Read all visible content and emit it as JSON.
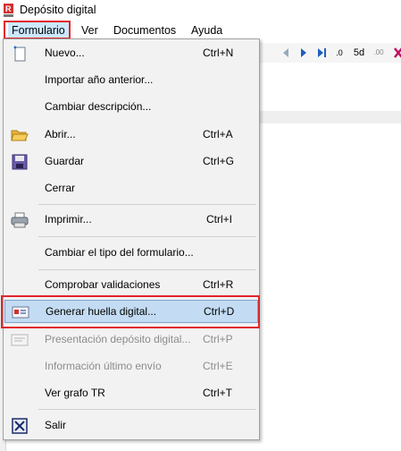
{
  "window": {
    "title": "Depósito digital"
  },
  "menubar": {
    "items": [
      {
        "label": "Formulario"
      },
      {
        "label": "Ver"
      },
      {
        "label": "Documentos"
      },
      {
        "label": "Ayuda"
      }
    ]
  },
  "toolbar": {
    "nav_labels": [
      "5d"
    ],
    "decimal_labels": [
      ".0",
      ".00"
    ]
  },
  "dropdown": {
    "items": [
      {
        "label": "Nuevo...",
        "shortcut": "Ctrl+N",
        "icon": "new-document-icon",
        "enabled": true
      },
      {
        "label": "Importar año anterior...",
        "shortcut": "",
        "enabled": true
      },
      {
        "label": "Cambiar descripción...",
        "shortcut": "",
        "enabled": true
      },
      {
        "label": "Abrir...",
        "shortcut": "Ctrl+A",
        "icon": "open-folder-icon",
        "enabled": true
      },
      {
        "label": "Guardar",
        "shortcut": "Ctrl+G",
        "icon": "save-icon",
        "enabled": true
      },
      {
        "label": "Cerrar",
        "shortcut": "",
        "enabled": true
      },
      {
        "label": "Imprimir...",
        "shortcut": "Ctrl+I",
        "icon": "printer-icon",
        "enabled": true
      },
      {
        "label": "Cambiar el tipo del formulario...",
        "shortcut": "",
        "enabled": true
      },
      {
        "label": "Comprobar validaciones",
        "shortcut": "Ctrl+R",
        "enabled": true
      },
      {
        "label": "Generar huella digital...",
        "shortcut": "Ctrl+D",
        "icon": "fingerprint-card-icon",
        "enabled": true,
        "highlighted": true
      },
      {
        "label": "Presentación depósito digital...",
        "shortcut": "Ctrl+P",
        "icon": "submit-card-icon",
        "enabled": false
      },
      {
        "label": "Información último envío",
        "shortcut": "Ctrl+E",
        "enabled": false
      },
      {
        "label": "Ver grafo TR",
        "shortcut": "Ctrl+T",
        "enabled": true
      },
      {
        "label": "Salir",
        "shortcut": "",
        "icon": "exit-icon",
        "enabled": true
      }
    ]
  },
  "colors": {
    "highlight": "#c3dcf3",
    "annotation": "#e0262a",
    "menu_bg": "#f2f2f2"
  }
}
